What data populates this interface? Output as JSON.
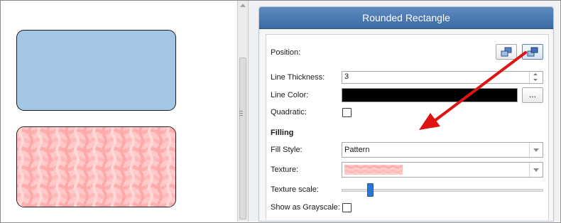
{
  "panel": {
    "title": "Rounded Rectangle",
    "position_label": "Position:",
    "line_thickness_label": "Line Thickness:",
    "line_thickness_value": "3",
    "line_color_label": "Line Color:",
    "line_color_value": "#000000",
    "line_color_button": "...",
    "quadratic_label": "Quadratic:",
    "quadratic_checked": false,
    "filling_header": "Filling",
    "fill_style_label": "Fill Style:",
    "fill_style_value": "Pattern",
    "texture_label": "Texture:",
    "texture_scale_label": "Texture scale:",
    "texture_scale_fraction": 0.13,
    "show_grayscale_label": "Show as Grayscale:",
    "show_grayscale_checked": false
  },
  "icons": {
    "send_backward": "send-backward-icon",
    "bring_forward": "bring-forward-icon",
    "annotation": "red-arrow-icon"
  },
  "colors": {
    "header": "#4a78b3",
    "shape_fill_blue": "#a5c5e4",
    "pattern_pink": "#ffc8c8",
    "annotation_red": "#e01414",
    "slider_thumb": "#2a77d6"
  }
}
